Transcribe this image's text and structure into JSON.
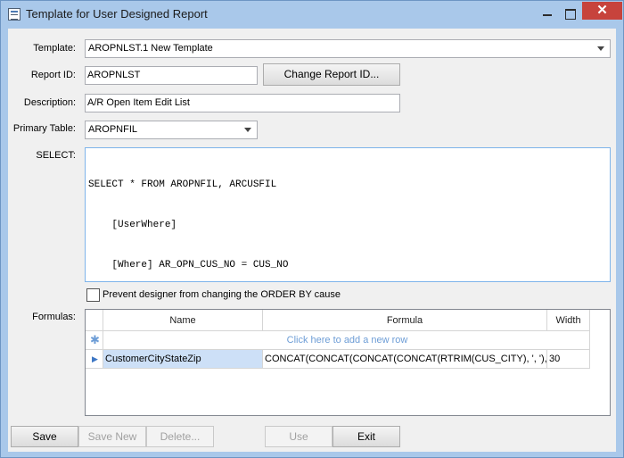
{
  "window": {
    "title": "Template for User Designed Report"
  },
  "form": {
    "template_label": "Template:",
    "template_value": "AROPNLST.1  New Template",
    "report_id_label": "Report ID:",
    "report_id_value": "AROPNLST",
    "change_report_id_button": "Change Report ID...",
    "description_label": "Description:",
    "description_value": "A/R Open Item Edit List",
    "primary_table_label": "Primary Table:",
    "primary_table_value": "AROPNFIL",
    "select_label": "SELECT:",
    "select_lines": [
      "SELECT * FROM AROPNFIL, ARCUSFIL",
      "    [UserWhere]",
      "    [Where] AR_OPN_CUS_NO = CUS_NO"
    ],
    "prevent_checkbox_label": "Prevent designer from changing the ORDER BY cause",
    "prevent_checked": false
  },
  "formulas": {
    "label": "Formulas:",
    "columns": [
      "Name",
      "Formula",
      "Width"
    ],
    "new_row_text": "Click here to add a new row",
    "rows": [
      {
        "name": "CustomerCityStateZip",
        "formula": "CONCAT(CONCAT(CONCAT(CONCAT(RTRIM(CUS_CITY), ',  '), ...",
        "width": "30"
      }
    ]
  },
  "buttons": {
    "save": "Save",
    "save_new": "Save New",
    "delete": "Delete...",
    "use": "Use",
    "exit": "Exit"
  }
}
